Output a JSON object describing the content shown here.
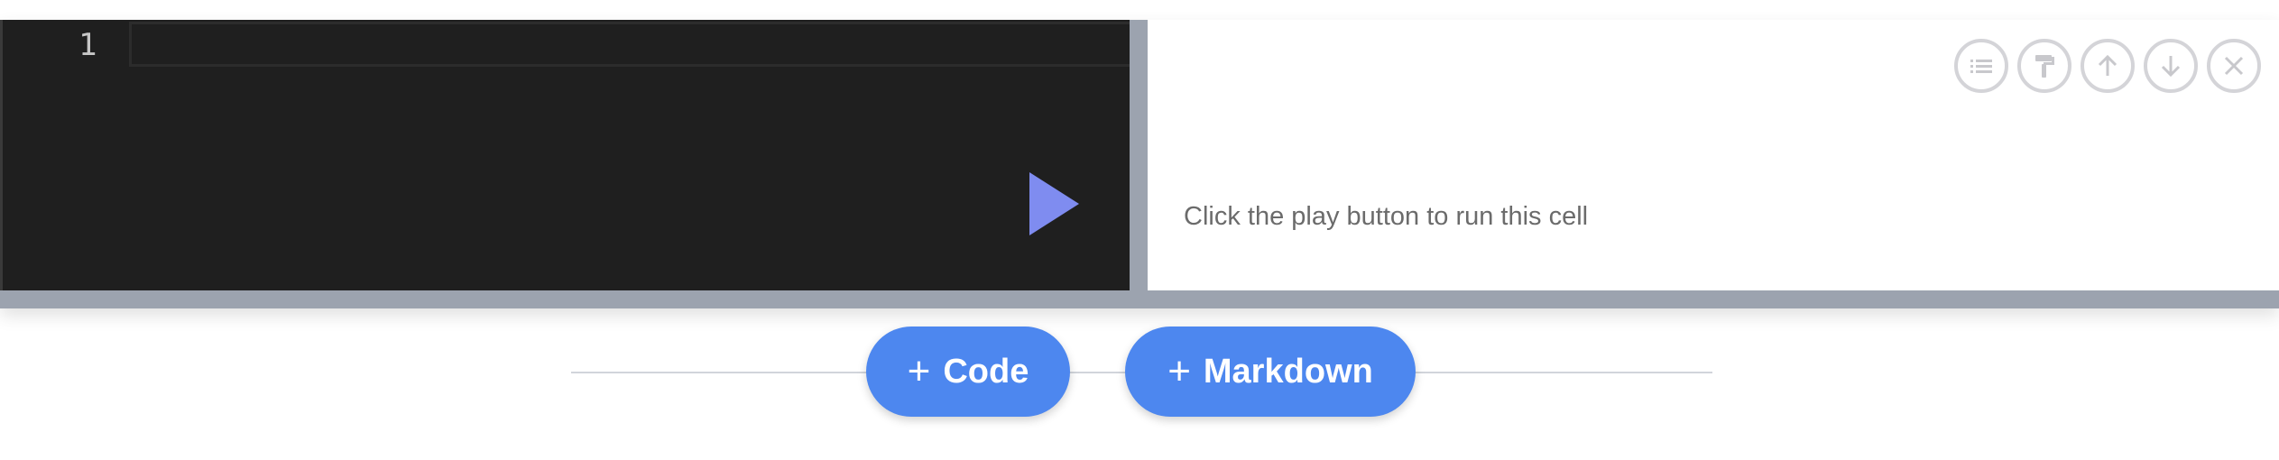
{
  "editor": {
    "line_numbers": [
      "1"
    ],
    "code": ""
  },
  "output": {
    "hint": "Click the play button to run this cell"
  },
  "toolbar": {
    "icons": [
      "list-icon",
      "paint-roller-icon",
      "arrow-up-icon",
      "arrow-down-icon",
      "close-icon"
    ]
  },
  "add_buttons": {
    "plus": "+",
    "code_label": "Code",
    "markdown_label": "Markdown"
  },
  "colors": {
    "accent": "#4d87ef",
    "play": "#7f8cf0",
    "editor_bg": "#1f1f1f",
    "cell_border": "#9ca3af"
  }
}
